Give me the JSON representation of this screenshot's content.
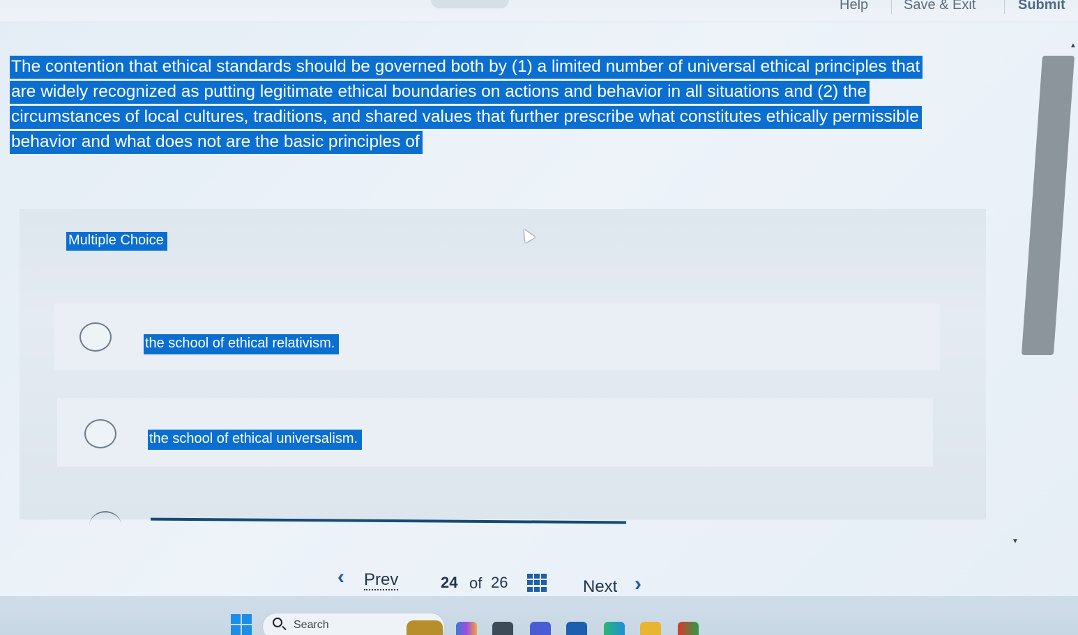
{
  "topbar": {
    "help": "Help",
    "save_exit": "Save & Exit",
    "submit": "Submit"
  },
  "question": {
    "lines": [
      "The contention that ethical standards should be governed both by (1) a limited number of universal ethical principles that",
      "are widely recognized as putting legitimate ethical boundaries on actions and behavior in all situations and (2) the",
      "circumstances of local cultures, traditions, and shared values that further prescribe what constitutes ethically permissible",
      "behavior and what does not are the basic principles of"
    ]
  },
  "card": {
    "type_label": "Multiple Choice",
    "options": [
      {
        "text": "the school of ethical relativism."
      },
      {
        "text": "the school of ethical universalism."
      }
    ]
  },
  "pager": {
    "prev": "Prev",
    "current": "24",
    "of": "of",
    "total": "26",
    "next": "Next"
  },
  "taskbar": {
    "search_placeholder": "Search"
  },
  "colors": {
    "highlight": "#0a6fd0",
    "accent": "#1d5fa8"
  },
  "icons": [
    "chevron-left-icon",
    "grid-icon",
    "chevron-right-icon",
    "windows-start-icon",
    "search-icon"
  ]
}
